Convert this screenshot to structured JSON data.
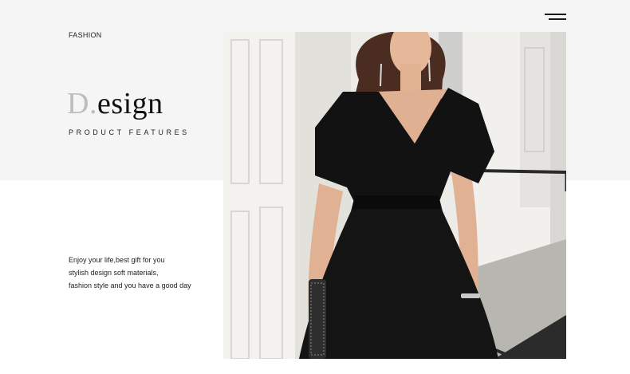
{
  "header": {
    "brand_label": "FASHION",
    "menu_icon": "hamburger-menu-icon"
  },
  "hero": {
    "title_first_letter": "D",
    "title_dot": ".",
    "title_rest": "esign",
    "subtitle": "PRODUCT FEATURES"
  },
  "blurb": {
    "lines": [
      "Enjoy your life,best gift for you",
      "stylish design soft materials,",
      "fashion style and you have a good day"
    ]
  },
  "colors": {
    "band_background": "#f5f5f5",
    "page_background": "#ffffff",
    "text": "#222222",
    "title_accent": "#bdbdbd",
    "dress": "#121212"
  }
}
